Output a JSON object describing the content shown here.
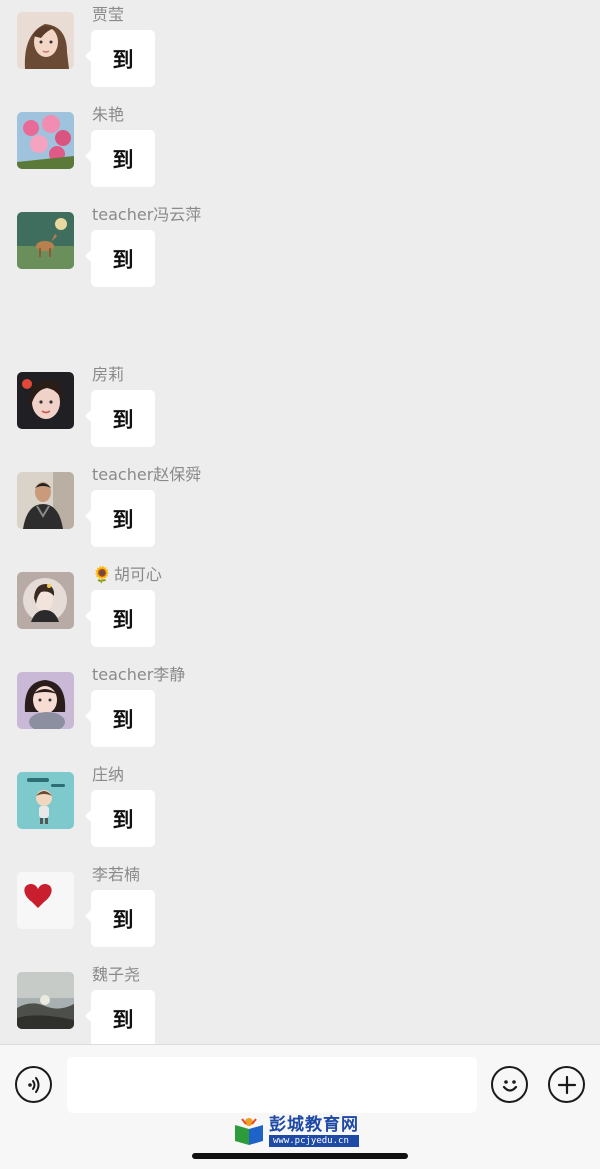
{
  "messages": [
    {
      "name": "贾莹",
      "text": "到",
      "avatar": "avatar-girl-selfie"
    },
    {
      "name": "朱艳",
      "text": "到",
      "avatar": "avatar-pink-flowers"
    },
    {
      "name": "teacher冯云萍",
      "text": "到",
      "avatar": "avatar-deer-forest"
    },
    {
      "name": "房莉",
      "text": "到",
      "avatar": "avatar-girl-portrait"
    },
    {
      "name": "teacher赵保舜",
      "text": "到",
      "avatar": "avatar-boy-photo"
    },
    {
      "name": "胡可心",
      "prefix": "🌻",
      "text": "到",
      "avatar": "avatar-girl-illustration"
    },
    {
      "name": "teacher李静",
      "text": "到",
      "avatar": "avatar-girl-cat"
    },
    {
      "name": "庄纳",
      "text": "到",
      "avatar": "avatar-cartoon-boy"
    },
    {
      "name": "李若楠",
      "text": "到",
      "avatar": "avatar-red-heart"
    },
    {
      "name": "魏子尧",
      "text": "到",
      "avatar": "avatar-landscape-sunset"
    }
  ],
  "input": {
    "value": "",
    "placeholder": ""
  },
  "toolbar": {
    "voice_icon": "voice-icon",
    "emoji_icon": "emoji-icon",
    "plus_icon": "plus-icon"
  },
  "watermark": {
    "title": "彭城教育网",
    "url": "www.pcjyedu.cn"
  },
  "colors": {
    "background": "#ededed",
    "bubble": "#ffffff",
    "name": "#8a8a8a",
    "watermark": "#1e4aa6"
  }
}
